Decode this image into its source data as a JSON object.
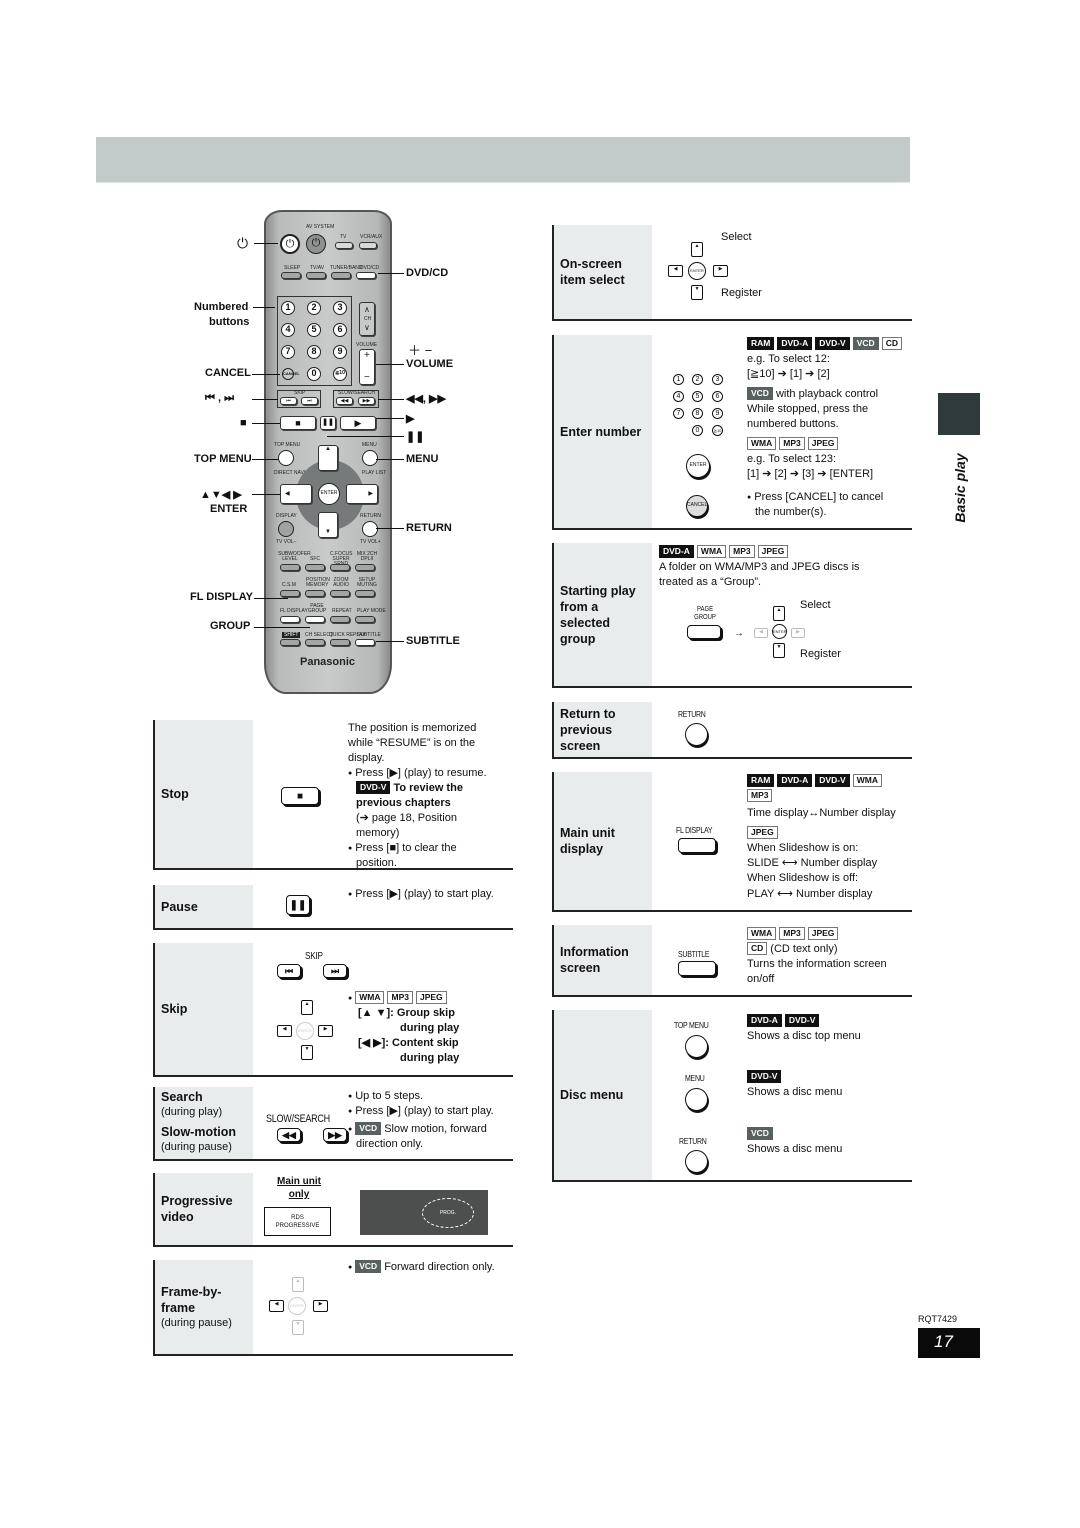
{
  "page": {
    "section_tab_label": "Basic play",
    "doc_code": "RQT7429",
    "page_number": "17"
  },
  "remote": {
    "brand": "Panasonic",
    "labels": {
      "av_system": "AV SYSTEM",
      "tv": "TV",
      "vcr_aux": "VCR/AUX",
      "sleep": "SLEEP",
      "tv_av": "TV/AV",
      "tuner_band": "TUNER/BAND",
      "dvd_cd": "DVD/CD",
      "ch": "CH",
      "volume": "VOLUME",
      "skip": "SKIP",
      "slow_search": "SLOW/SEARCH",
      "top_menu": "TOP MENU",
      "menu": "MENU",
      "direct_navigator": "DIRECT NAVIGATOR",
      "play_list": "PLAY LIST",
      "enter": "ENTER",
      "display": "DISPLAY",
      "return": "RETURN",
      "tv_vol_minus": "TV VOL−",
      "tv_vol_plus": "TV VOL+",
      "subwoofer_level": "SUBWOOFER LEVEL",
      "sfc": "SFC",
      "c_focus": "C.FOCUS SUPER SRND",
      "mix_2ch": "MIX 2CH DPLII",
      "csm": "C.S.M",
      "position_memory": "POSITION MEMORY",
      "zoom_audio": "ZOOM AUDIO",
      "setup_muting": "SETUP MUTING",
      "fl_display": "FL DISPLAY",
      "page_group": "PAGE GROUP",
      "repeat": "REPEAT",
      "play_mode": "PLAY MODE",
      "shift": "SHIFT",
      "ch_select": "CH SELECT",
      "quick_replay": "QUICK REPLAY",
      "subtitle": "SUBTITLE",
      "cancel": "CANCEL",
      "ge10": "≧10"
    },
    "numbers": [
      "1",
      "2",
      "3",
      "4",
      "5",
      "6",
      "7",
      "8",
      "9",
      "0"
    ],
    "callouts_left": {
      "power": "⏻",
      "numbered": "Numbered",
      "buttons": "buttons",
      "cancel": "CANCEL",
      "skip": "⏮ , ⏭",
      "stop": "■",
      "top_menu": "TOP MENU",
      "arrows": "▲▼◀ ▶",
      "enter": "ENTER",
      "fl_display": "FL DISPLAY",
      "group": "GROUP"
    },
    "callouts_right": {
      "dvd_cd": "DVD/CD",
      "plus_minus": "＋ −",
      "volume": "VOLUME",
      "search": "◀◀, ▶▶",
      "play": "▶",
      "pause": "❚❚",
      "menu": "MENU",
      "return": "RETURN",
      "subtitle": "SUBTITLE"
    }
  },
  "left_sections": {
    "stop": {
      "title": "Stop",
      "key": "■",
      "lines": {
        "l1": "The position is memorized",
        "l2": "while “RESUME” is on the",
        "l3": "display.",
        "b1": "Press [▶] (play) to resume.",
        "tag": "DVD-V",
        "bold1": "To review the",
        "bold2": "previous chapters",
        "ref1": "(➔ page 18, Position",
        "ref2": "memory)",
        "b2a": "Press [■] to clear the",
        "b2b": "position."
      }
    },
    "pause": {
      "title": "Pause",
      "key": "❚❚",
      "line": "Press [▶] (play) to start play."
    },
    "skip": {
      "title": "Skip",
      "key_caption": "SKIP",
      "key_prev": "⏮",
      "key_next": "⏭",
      "tags": [
        "WMA",
        "MP3",
        "JPEG"
      ],
      "group_skip_keys": "[▲ ▼]:",
      "group_skip_a": "Group skip",
      "group_skip_b": "during play",
      "content_skip_keys": "[◀ ▶]:",
      "content_skip_a": "Content skip",
      "content_skip_b": "during play"
    },
    "search": {
      "title1": "Search",
      "sub1": "(during play)",
      "title2": "Slow-motion",
      "sub2": "(during pause)",
      "key_caption": "SLOW/SEARCH",
      "key_rev": "◀◀",
      "key_fwd": "▶▶",
      "b1": "Up to 5 steps.",
      "b2": "Press [▶] (play) to start play.",
      "tag": "VCD",
      "b3a": "Slow motion, forward",
      "b3b": "direction only."
    },
    "progressive": {
      "title1": "Progressive",
      "title2": "video",
      "note1": "Main unit",
      "note2": "only",
      "btn1": "RDS",
      "btn2": "PROGRESSIVE",
      "screen_label": "PROG."
    },
    "frame": {
      "title1": "Frame-by-",
      "title2": "frame",
      "sub": "(during pause)",
      "tag": "VCD",
      "line": "Forward direction only."
    }
  },
  "right_sections": {
    "onscreen": {
      "title1": "On-screen",
      "title2": "item select",
      "select": "Select",
      "register": "Register"
    },
    "enter_number": {
      "title": "Enter number",
      "tags1": [
        {
          "label": "RAM",
          "style": "blk"
        },
        {
          "label": "DVD-A",
          "style": "blk"
        },
        {
          "label": "DVD-V",
          "style": "blk"
        },
        {
          "label": "VCD",
          "style": "gry"
        },
        {
          "label": "CD",
          "style": "wht"
        }
      ],
      "eg1": "e.g. To select 12:",
      "seq1": "[≧10] ➔ [1] ➔ [2]",
      "vcd_tag": "VCD",
      "vcd_text": "with playback control",
      "while1": "While stopped, press the",
      "while2": "numbered buttons.",
      "tags2": [
        "WMA",
        "MP3",
        "JPEG"
      ],
      "eg2": "e.g. To select 123:",
      "seq2": "[1] ➔ [2] ➔ [3] ➔ [ENTER]",
      "cancel1": "Press [CANCEL] to cancel",
      "cancel2": "the number(s).",
      "enter_key": "ENTER",
      "cancel_key": "CANCEL"
    },
    "group": {
      "title1": "Starting play",
      "title2": "from a",
      "title3": "selected",
      "title4": "group",
      "tags": [
        {
          "label": "DVD-A",
          "style": "blk"
        },
        {
          "label": "WMA",
          "style": "wht"
        },
        {
          "label": "MP3",
          "style": "wht"
        },
        {
          "label": "JPEG",
          "style": "wht"
        }
      ],
      "desc1": "A folder on WMA/MP3 and JPEG discs is",
      "desc2": "treated as a “Group”.",
      "key_cap1": "PAGE",
      "key_cap2": "GROUP",
      "arrow": "→",
      "select": "Select",
      "register": "Register"
    },
    "return": {
      "title1": "Return to",
      "title2": "previous",
      "title3": "screen",
      "key_caption": "RETURN"
    },
    "main_display": {
      "title1": "Main unit",
      "title2": "display",
      "key_caption": "FL DISPLAY",
      "tags1": [
        {
          "label": "RAM",
          "style": "blk"
        },
        {
          "label": "DVD-A",
          "style": "blk"
        },
        {
          "label": "DVD-V",
          "style": "blk"
        },
        {
          "label": "WMA",
          "style": "wht"
        }
      ],
      "tag_mp3": "MP3",
      "time_line": "Time display↔Number display",
      "tag_jpeg": "JPEG",
      "on1": "When Slideshow is on:",
      "on2": "SLIDE ⟷ Number display",
      "off1": "When Slideshow is off:",
      "off2": "PLAY ⟷ Number display"
    },
    "info": {
      "title1": "Information",
      "title2": "screen",
      "key_caption": "SUBTITLE",
      "tags": [
        "WMA",
        "MP3",
        "JPEG"
      ],
      "cd_tag": "CD",
      "cd_text": "(CD text only)",
      "line1": "Turns the information screen",
      "line2": "on/off"
    },
    "disc_menu": {
      "title": "Disc menu",
      "top_caption": "TOP MENU",
      "top_tag1": "DVD-A",
      "top_tag2": "DVD-V",
      "top_text": "Shows a disc top menu",
      "menu_caption": "MENU",
      "menu_tag": "DVD-V",
      "menu_text": "Shows a disc menu",
      "return_caption": "RETURN",
      "return_tag": "VCD",
      "return_text": "Shows a disc menu"
    }
  }
}
